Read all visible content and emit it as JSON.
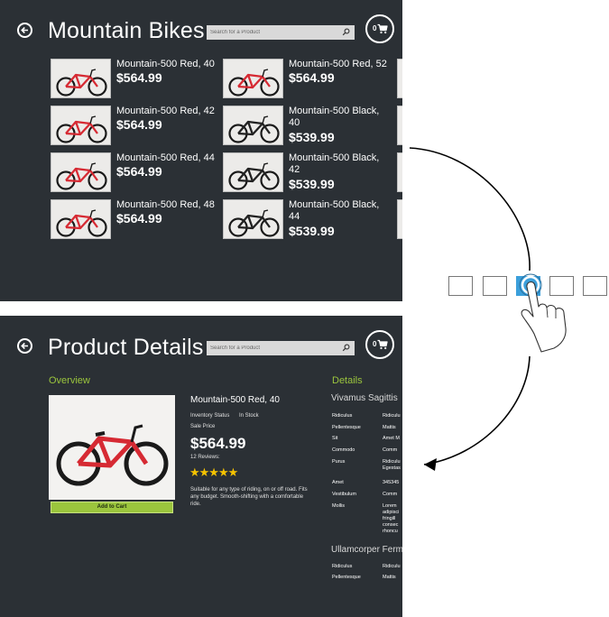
{
  "top_screen": {
    "title": "Mountain Bikes",
    "search_placeholder": "Search for a Product",
    "cart_count": "0",
    "products": [
      {
        "name": "Mountain-500 Red, 40",
        "price": "$564.99",
        "color": "#d62a33"
      },
      {
        "name": "Mountain-500 Red, 52",
        "price": "$564.99",
        "color": "#d62a33"
      },
      {
        "name": "Mountain-500 Red, 42",
        "price": "$564.99",
        "color": "#d62a33"
      },
      {
        "name": "Mountain-500 Black, 40",
        "price": "$539.99",
        "color": "#222222"
      },
      {
        "name": "Mountain-500 Red, 44",
        "price": "$564.99",
        "color": "#d62a33"
      },
      {
        "name": "Mountain-500 Black, 42",
        "price": "$539.99",
        "color": "#222222"
      },
      {
        "name": "Mountain-500 Red, 48",
        "price": "$564.99",
        "color": "#d62a33"
      },
      {
        "name": "Mountain-500 Black, 44",
        "price": "$539.99",
        "color": "#222222"
      }
    ]
  },
  "bottom_screen": {
    "title": "Product Details",
    "search_placeholder": "Search for a Product",
    "cart_count": "0",
    "overview_heading": "Overview",
    "details_heading": "Details",
    "product": {
      "name": "Mountain-500 Red, 40",
      "inventory_label": "Inventory Status",
      "inventory_value": "In Stock",
      "sale_label": "Sale Price",
      "price": "$564.99",
      "reviews": "12 Reviews:",
      "stars": "★★★★★",
      "rating": 5,
      "description": "Suitable for any type of riding, on or off road. Fits any budget. Smooth-shifting with a comfortable ride.",
      "add_to_cart": "Add to Cart"
    },
    "spec_groups": [
      {
        "title": "Vivamus Sagittis",
        "rows": [
          {
            "key": "Ridiculus",
            "value": "Ridiculu"
          },
          {
            "key": "Pellentesque",
            "value": "Mattis"
          },
          {
            "key": "Sit",
            "value": "Amet M"
          },
          {
            "key": "Commodo",
            "value": "Comm"
          },
          {
            "key": "Purus",
            "value": "Ridiculu Egestas"
          },
          {
            "key": "Amet",
            "value": "345345"
          },
          {
            "key": "Vestibulum",
            "value": "Comm"
          },
          {
            "key": "Mollis",
            "value": "Lorem adipisci fringill consec rhoncu"
          }
        ]
      },
      {
        "title": "Ullamcorper Ferm",
        "rows": [
          {
            "key": "Ridiculus",
            "value": "Ridiculu"
          },
          {
            "key": "Pellentesque",
            "value": "Mattis"
          }
        ]
      }
    ]
  },
  "colors": {
    "screen_bg": "#2b3035",
    "accent_green": "#9bc53d",
    "star": "#f6c300",
    "gesture_blue": "#3b9fdb"
  },
  "icons": {
    "back": "back-arrow-icon",
    "search": "search-icon",
    "cart": "cart-icon",
    "hand": "hand-pointer-icon"
  }
}
